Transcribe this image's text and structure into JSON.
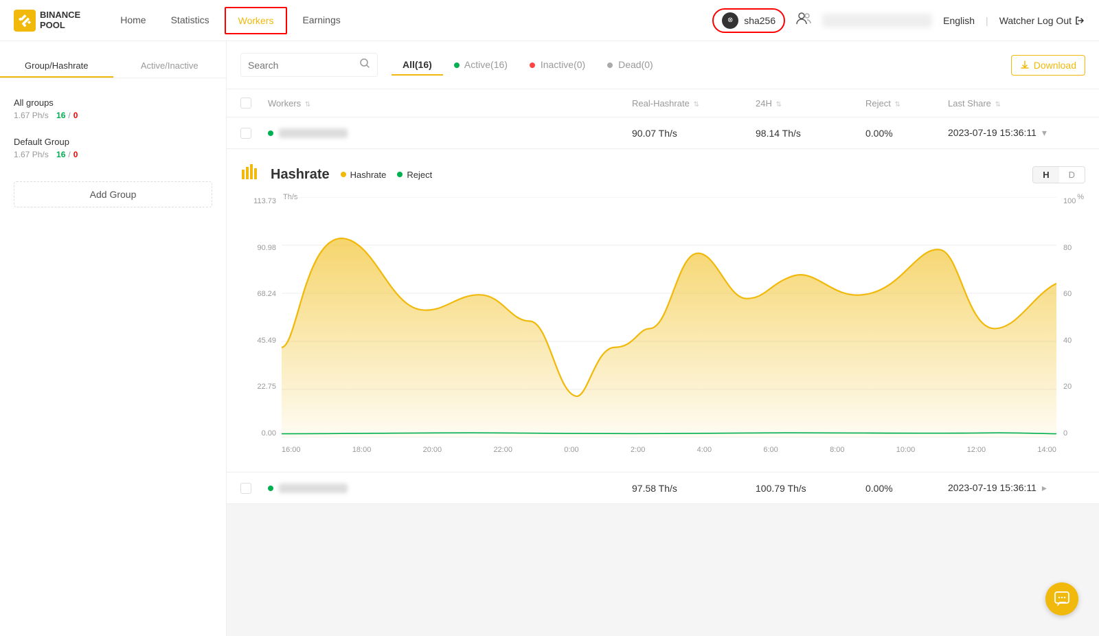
{
  "app": {
    "brand": "BINANCE",
    "pool": "POOL"
  },
  "nav": {
    "items": [
      {
        "id": "home",
        "label": "Home",
        "active": false
      },
      {
        "id": "statistics",
        "label": "Statistics",
        "active": false
      },
      {
        "id": "workers",
        "label": "Workers",
        "active": true
      },
      {
        "id": "earnings",
        "label": "Earnings",
        "active": false
      }
    ]
  },
  "header": {
    "account": {
      "icon": "⊗",
      "name": "sha256"
    },
    "language": "English",
    "watcher_logout": "Watcher Log Out"
  },
  "sidebar": {
    "tabs": [
      {
        "id": "group-hashrate",
        "label": "Group/Hashrate",
        "active": true
      },
      {
        "id": "active-inactive",
        "label": "Active/Inactive",
        "active": false
      }
    ],
    "groups": [
      {
        "name": "All groups",
        "hashrate": "1.67 Ph/s",
        "active": "16",
        "inactive": "0"
      },
      {
        "name": "Default Group",
        "hashrate": "1.67 Ph/s",
        "active": "16",
        "inactive": "0"
      }
    ],
    "add_group_label": "Add Group"
  },
  "filter_bar": {
    "search_placeholder": "Search",
    "tabs": [
      {
        "id": "all",
        "label": "All(16)",
        "active": true,
        "dot": null
      },
      {
        "id": "active",
        "label": "Active(16)",
        "active": false,
        "dot": "green"
      },
      {
        "id": "inactive",
        "label": "Inactive(0)",
        "active": false,
        "dot": "red"
      },
      {
        "id": "dead",
        "label": "Dead(0)",
        "active": false,
        "dot": "gray"
      }
    ],
    "download_label": "Download"
  },
  "table": {
    "headers": [
      {
        "id": "check",
        "label": ""
      },
      {
        "id": "workers",
        "label": "Workers"
      },
      {
        "id": "real-hashrate",
        "label": "Real-Hashrate"
      },
      {
        "id": "24h",
        "label": "24H"
      },
      {
        "id": "reject",
        "label": "Reject"
      },
      {
        "id": "last-share",
        "label": "Last Share"
      }
    ],
    "row1": {
      "status": "active",
      "name_blurred": true,
      "real_hashrate": "90.07 Th/s",
      "hashrate_24h": "98.14 Th/s",
      "reject": "0.00%",
      "last_share": "2023-07-19 15:36:11",
      "last_share_arrow": "▾"
    },
    "row2": {
      "status": "active",
      "name_blurred": true,
      "real_hashrate": "97.58 Th/s",
      "hashrate_24h": "100.79 Th/s",
      "reject": "0.00%",
      "last_share": "2023-07-19 15:36:11",
      "last_share_arrow": "▸"
    }
  },
  "chart": {
    "title": "Hashrate",
    "icon": "📊",
    "legend": [
      {
        "id": "hashrate",
        "label": "Hashrate",
        "color": "#f0b90b"
      },
      {
        "id": "reject",
        "label": "Reject",
        "color": "#00b050"
      }
    ],
    "period_buttons": [
      {
        "id": "H",
        "label": "H",
        "active": true
      },
      {
        "id": "D",
        "label": "D",
        "active": false
      }
    ],
    "y_axis_left": [
      "113.73",
      "90.98",
      "68.24",
      "45.49",
      "22.75",
      "0.00"
    ],
    "y_axis_right": [
      "100",
      "80",
      "60",
      "40",
      "20",
      "0"
    ],
    "x_axis": [
      "16:00",
      "18:00",
      "20:00",
      "22:00",
      "0:00",
      "2:00",
      "4:00",
      "6:00",
      "8:00",
      "10:00",
      "12:00",
      "14:00"
    ],
    "unit_left": "Th/s",
    "unit_right": "%"
  },
  "chat_button": {
    "icon": "💬"
  }
}
